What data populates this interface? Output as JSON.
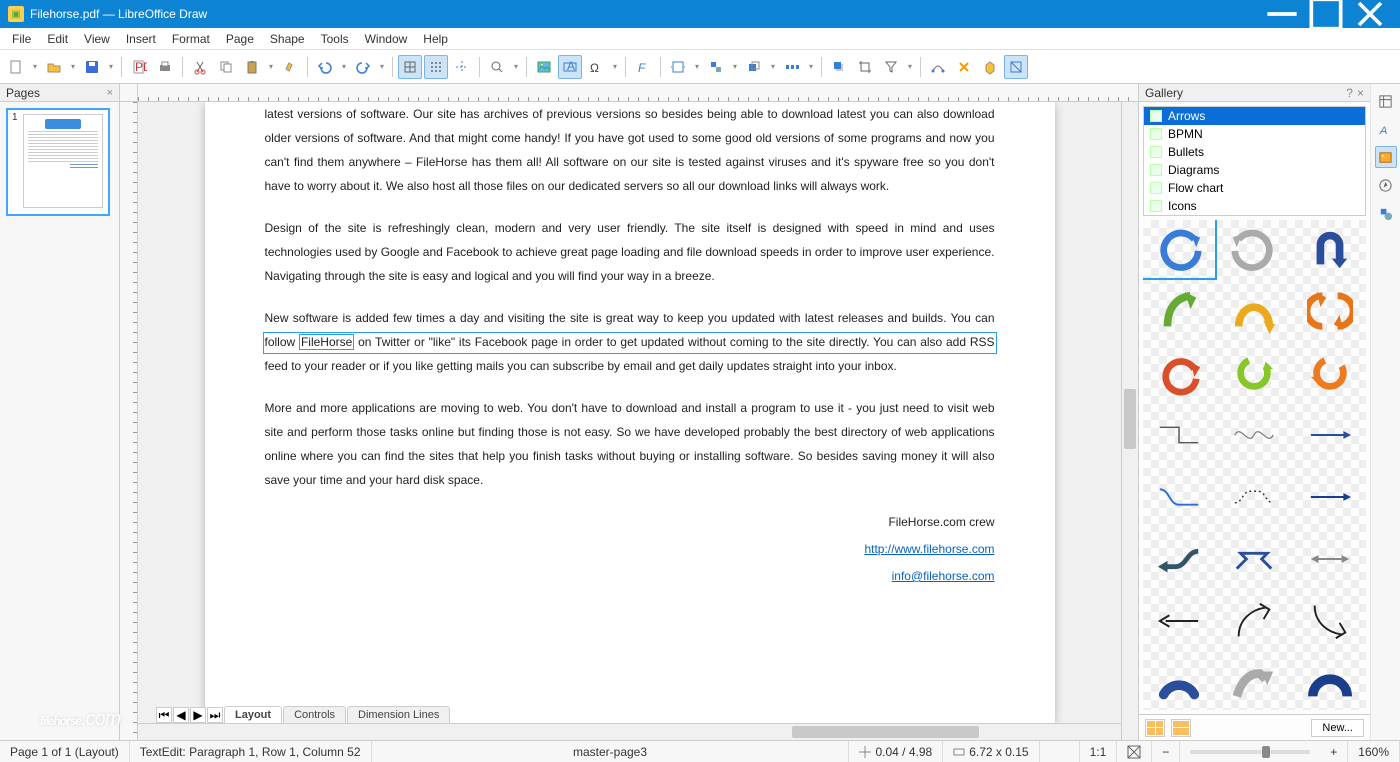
{
  "window": {
    "title": "Filehorse.pdf — LibreOffice Draw"
  },
  "menubar": [
    "File",
    "Edit",
    "View",
    "Insert",
    "Format",
    "Page",
    "Shape",
    "Tools",
    "Window",
    "Help"
  ],
  "pagesPanel": {
    "title": "Pages",
    "pageNum": "1"
  },
  "gallery": {
    "title": "Gallery",
    "categories": [
      "Arrows",
      "BPMN",
      "Bullets",
      "Diagrams",
      "Flow chart",
      "Icons"
    ],
    "newBtn": "New..."
  },
  "tabs": [
    "Layout",
    "Controls",
    "Dimension Lines"
  ],
  "document": {
    "p1": "latest versions of software.  Our site has archives of previous versions so besides being able to download latest you can also download older versions of software. And that might come handy! If you have got used to some good old versions of some programs and now you can't find them anywhere – FileHorse has them all! All software on our site is tested against viruses and it's spyware free so you don't have to worry about it. We also host all those files on our dedicated servers so all our download links will always work.",
    "p2": "Design of the site is refreshingly clean, modern and very user friendly. The site itself is designed with speed in mind and uses technologies used by Google and Facebook to achieve great page loading and file download speeds in order to improve user experience. Navigating through the site is easy and logical and you will find your way in a breeze.",
    "p3a": "New software is added few times a day and visiting the site is great way to keep you updated with latest releases and builds. You can follow ",
    "p3sel": "FileHorse",
    "p3b": " on Twitter or \"like\" its Facebook page in order to get updated without coming to the site directly. You can also add RSS feed to your reader or if you like getting mails you can subscribe by email and get daily updates straight into your inbox.",
    "p4": "More and more applications are moving to web.  You don't have to download and install a program to use it - you just need to visit web site and perform those tasks online but finding those is not easy. So we have developed probably the best directory of web applications online where you can find the sites that help you finish tasks without buying or installing software. So besides saving money it will also save your time and your hard disk space.",
    "sig1": "FileHorse.com crew",
    "sig2": "http://www.filehorse.com",
    "sig3": "info@filehorse.com"
  },
  "statusbar": {
    "page": "Page 1 of 1 (Layout)",
    "edit": "TextEdit: Paragraph 1, Row 1, Column 52",
    "master": "master-page3",
    "pos": "0.04 / 4.98",
    "size": "6.72 x 0.15",
    "ratio": "1:1",
    "zoom": "160%"
  },
  "watermark": {
    "brand": "filehorse",
    "suffix": ".com"
  }
}
